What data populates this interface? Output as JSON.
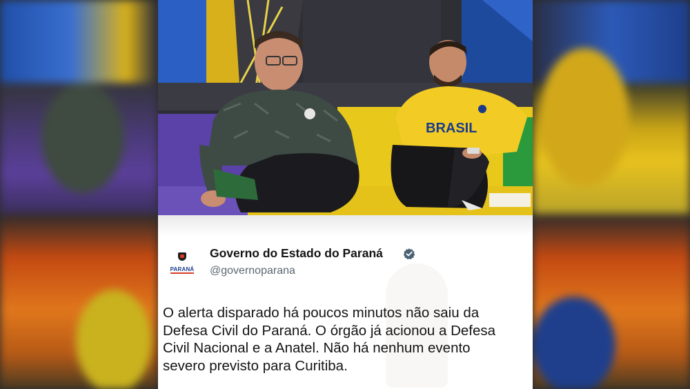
{
  "tweet": {
    "account_name": "Governo do Estado do Paraná",
    "handle": "@governoparana",
    "avatar_text": "PARANÁ",
    "text": "O alerta disparado há poucos minutos não saiu da\nDefesa Civil do Paraná. O órgão já acionou a Defesa\nCivil Nacional e a Anatel. Não há nenhum evento\nsevero previsto para Curitiba."
  },
  "video": {
    "jersey_text": "BRASIL"
  },
  "colors": {
    "verified": "#4a6274",
    "brand_blue": "#1a3d8c",
    "brand_red": "#d63b2a",
    "sofa_yellow": "#e9c81c",
    "sofa_purple": "#5a42a8",
    "jersey_yellow": "#f2cc24"
  },
  "icons": {
    "verified": "verified-badge-icon",
    "avatar": "parana-crest-icon"
  }
}
